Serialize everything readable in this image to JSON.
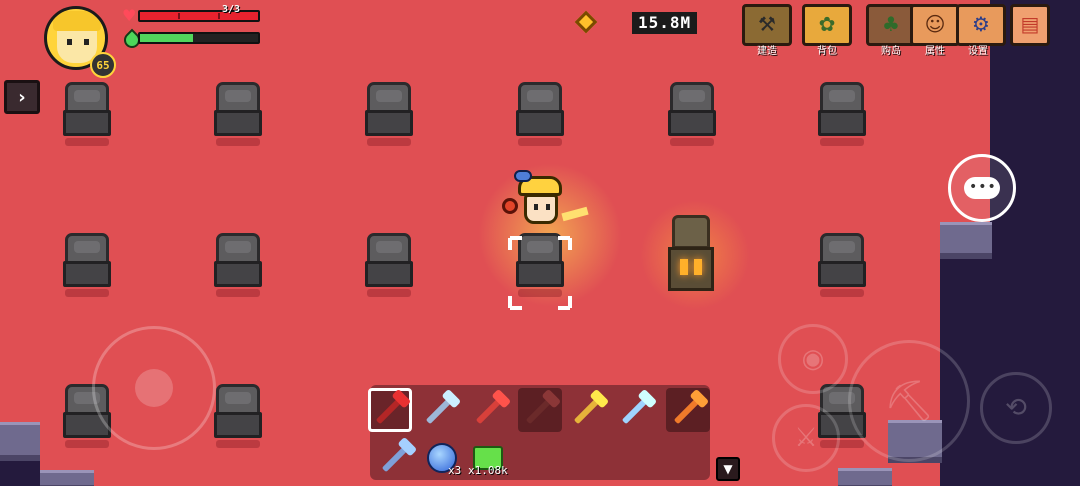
{
  "hud": {
    "player_level": "65",
    "health_text": "3/3",
    "health_fraction": 1.0,
    "energy_fraction": 0.45,
    "currency_amount": "15.8M"
  },
  "menu": {
    "build_label": "建造",
    "backpack_label": "背包",
    "shop_label": "购岛",
    "attributes_label": "属性",
    "settings_label": "设置"
  },
  "hotbar": {
    "slots": [
      "pickaxe",
      "shovel",
      "sword",
      "bow",
      "dagger",
      "crystal-staff",
      "spear"
    ],
    "selected_slot": 0,
    "second_row_counts": [
      "x3",
      "x1.08k"
    ]
  },
  "colors": {
    "floor": "#e04f53",
    "void": "#241a3d",
    "health": "#e8222e",
    "energy": "#52d65c",
    "gold": "#ffc02b"
  },
  "icons": {
    "expand_side": "chevron-right-icon",
    "chat": "chat-bubble-icon",
    "expand_hotbar": "chevron-down-icon"
  }
}
